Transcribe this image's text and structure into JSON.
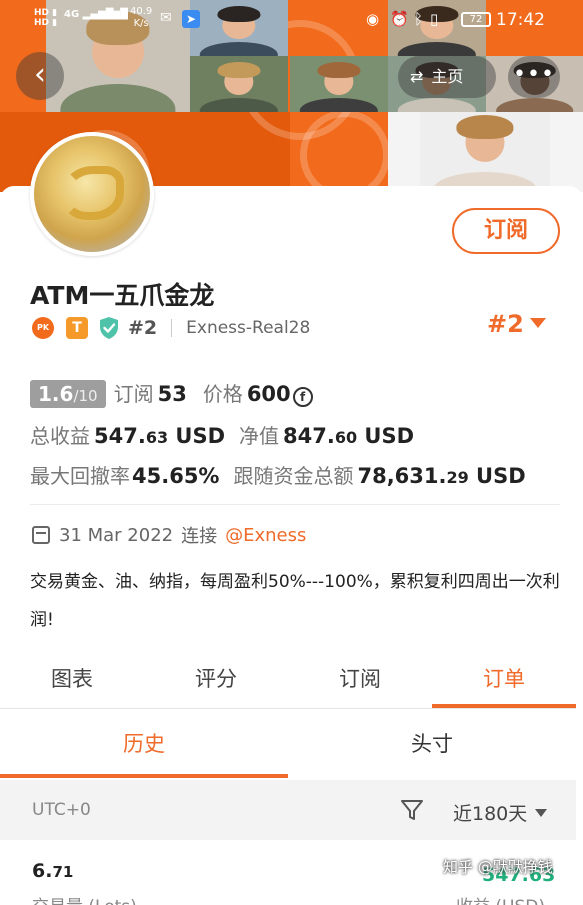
{
  "status_bar": {
    "network": "4G",
    "speed_value": "40.9",
    "speed_unit": "K/s",
    "battery": "72",
    "time": "17:42"
  },
  "nav": {
    "home_label": "主页"
  },
  "profile": {
    "subscribe_label": "订阅",
    "name": "ATM一五爪金龙",
    "badge_pk": "PK",
    "badge_t": "T",
    "rank": "#2",
    "account": "Exness-Real28",
    "rank_right": "#2"
  },
  "stats": {
    "score": "1.6",
    "score_max": "/10",
    "subscribers_label": "订阅",
    "subscribers": "53",
    "price_label": "价格",
    "price": "600",
    "price_currency_symbol": "f",
    "total_profit_label": "总收益",
    "total_profit_int": "547.",
    "total_profit_dec": "63",
    "total_profit_unit": " USD",
    "equity_label": "净值",
    "equity_int": "847.",
    "equity_dec": "60",
    "equity_unit": " USD",
    "max_drawdown_label": "最大回撤率",
    "max_drawdown": "45.65%",
    "follow_funds_label": "跟随资金总额",
    "follow_funds_int": "78,631.",
    "follow_funds_dec": "29",
    "follow_funds_unit": " USD"
  },
  "connection": {
    "date": "31 Mar 2022",
    "connect_label": "连接",
    "broker": "@Exness"
  },
  "description": "交易黄金、油、纳指，每周盈利50%---100%，累积复利四周出一次利润!",
  "tabs": [
    {
      "label": "图表",
      "active": false
    },
    {
      "label": "评分",
      "active": false
    },
    {
      "label": "订阅",
      "active": false
    },
    {
      "label": "订单",
      "active": true
    }
  ],
  "subtabs": [
    {
      "label": "历史",
      "active": true
    },
    {
      "label": "头寸",
      "active": false
    }
  ],
  "filter": {
    "timezone": "UTC+0",
    "period": "近180天"
  },
  "summary": {
    "lots_int": "6.",
    "lots_dec": "71",
    "lots_label": "交易量 (Lots)",
    "profit_value": "547.63",
    "profit_label": "收益 (USD)"
  },
  "watermark": "知乎 @默默挣钱",
  "colors": {
    "accent": "#f06a2a",
    "banner": "#f26a1b",
    "profit_green": "#21b07c",
    "score_grey": "#9e9e9e"
  }
}
